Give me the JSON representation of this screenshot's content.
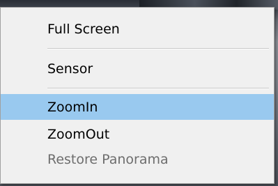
{
  "context_menu": {
    "items": [
      {
        "label": "Full Screen",
        "state": "normal"
      },
      {
        "label": "Sensor",
        "state": "normal"
      },
      {
        "label": "ZoomIn",
        "state": "highlighted"
      },
      {
        "label": "ZoomOut",
        "state": "normal"
      },
      {
        "label": "Restore Panorama",
        "state": "disabled"
      }
    ],
    "highlight_color": "#99c9ef",
    "disabled_color": "#6d6d6d"
  }
}
